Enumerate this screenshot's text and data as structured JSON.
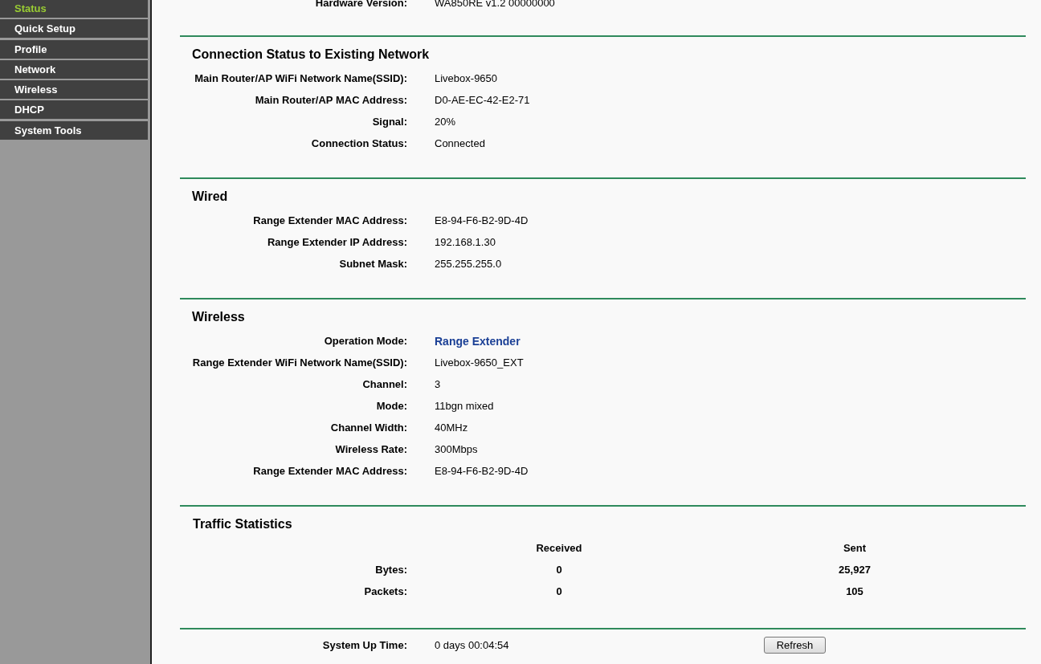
{
  "sidebar": {
    "items": [
      {
        "label": "Status",
        "selected": true
      },
      {
        "label": "Quick Setup",
        "selected": false
      },
      {
        "label": "Profile",
        "selected": false
      },
      {
        "label": "Network",
        "selected": false
      },
      {
        "label": "Wireless",
        "selected": false
      },
      {
        "label": "DHCP",
        "selected": false
      },
      {
        "label": "System Tools",
        "selected": false
      }
    ]
  },
  "top_rows": [
    {
      "label": "Hardware Version:",
      "value": "WA850RE v1.2 00000000"
    }
  ],
  "sections": [
    {
      "title": "Connection Status to Existing Network",
      "rows": [
        {
          "label": "Main Router/AP WiFi Network Name(SSID):",
          "value": "Livebox-9650",
          "kind": "text"
        },
        {
          "label": "Main Router/AP MAC Address:",
          "value": "D0-AE-EC-42-E2-71",
          "kind": "text"
        },
        {
          "label": "Signal:",
          "value": "20%",
          "kind": "text"
        },
        {
          "label": "Connection Status:",
          "value": "Connected",
          "kind": "text"
        }
      ]
    },
    {
      "title": "Wired",
      "rows": [
        {
          "label": "Range Extender MAC Address:",
          "value": "E8-94-F6-B2-9D-4D",
          "kind": "text"
        },
        {
          "label": "Range Extender IP Address:",
          "value": "192.168.1.30",
          "kind": "text"
        },
        {
          "label": "Subnet Mask:",
          "value": "255.255.255.0",
          "kind": "text"
        }
      ]
    },
    {
      "title": "Wireless",
      "rows": [
        {
          "label": "Operation Mode:",
          "value": "Range Extender",
          "kind": "highlight"
        },
        {
          "label": "Range Extender WiFi Network Name(SSID):",
          "value": "Livebox-9650_EXT",
          "kind": "text"
        },
        {
          "label": "Channel:",
          "value": "3",
          "kind": "text"
        },
        {
          "label": "Mode:",
          "value": "11bgn mixed",
          "kind": "text"
        },
        {
          "label": "Channel Width:",
          "value": "40MHz",
          "kind": "text"
        },
        {
          "label": "Wireless Rate:",
          "value": "300Mbps",
          "kind": "text"
        },
        {
          "label": "Range Extender MAC Address:",
          "value": "E8-94-F6-B2-9D-4D",
          "kind": "text"
        }
      ]
    }
  ],
  "traffic": {
    "title": "Traffic Statistics",
    "columns": [
      "Received",
      "Sent"
    ],
    "rows": [
      {
        "label": "Bytes:",
        "values": [
          "0",
          "25,927"
        ]
      },
      {
        "label": "Packets:",
        "values": [
          "0",
          "105"
        ]
      }
    ]
  },
  "uptime": {
    "label": "System Up Time:",
    "value": "0 days 00:04:54",
    "button": "Refresh"
  }
}
